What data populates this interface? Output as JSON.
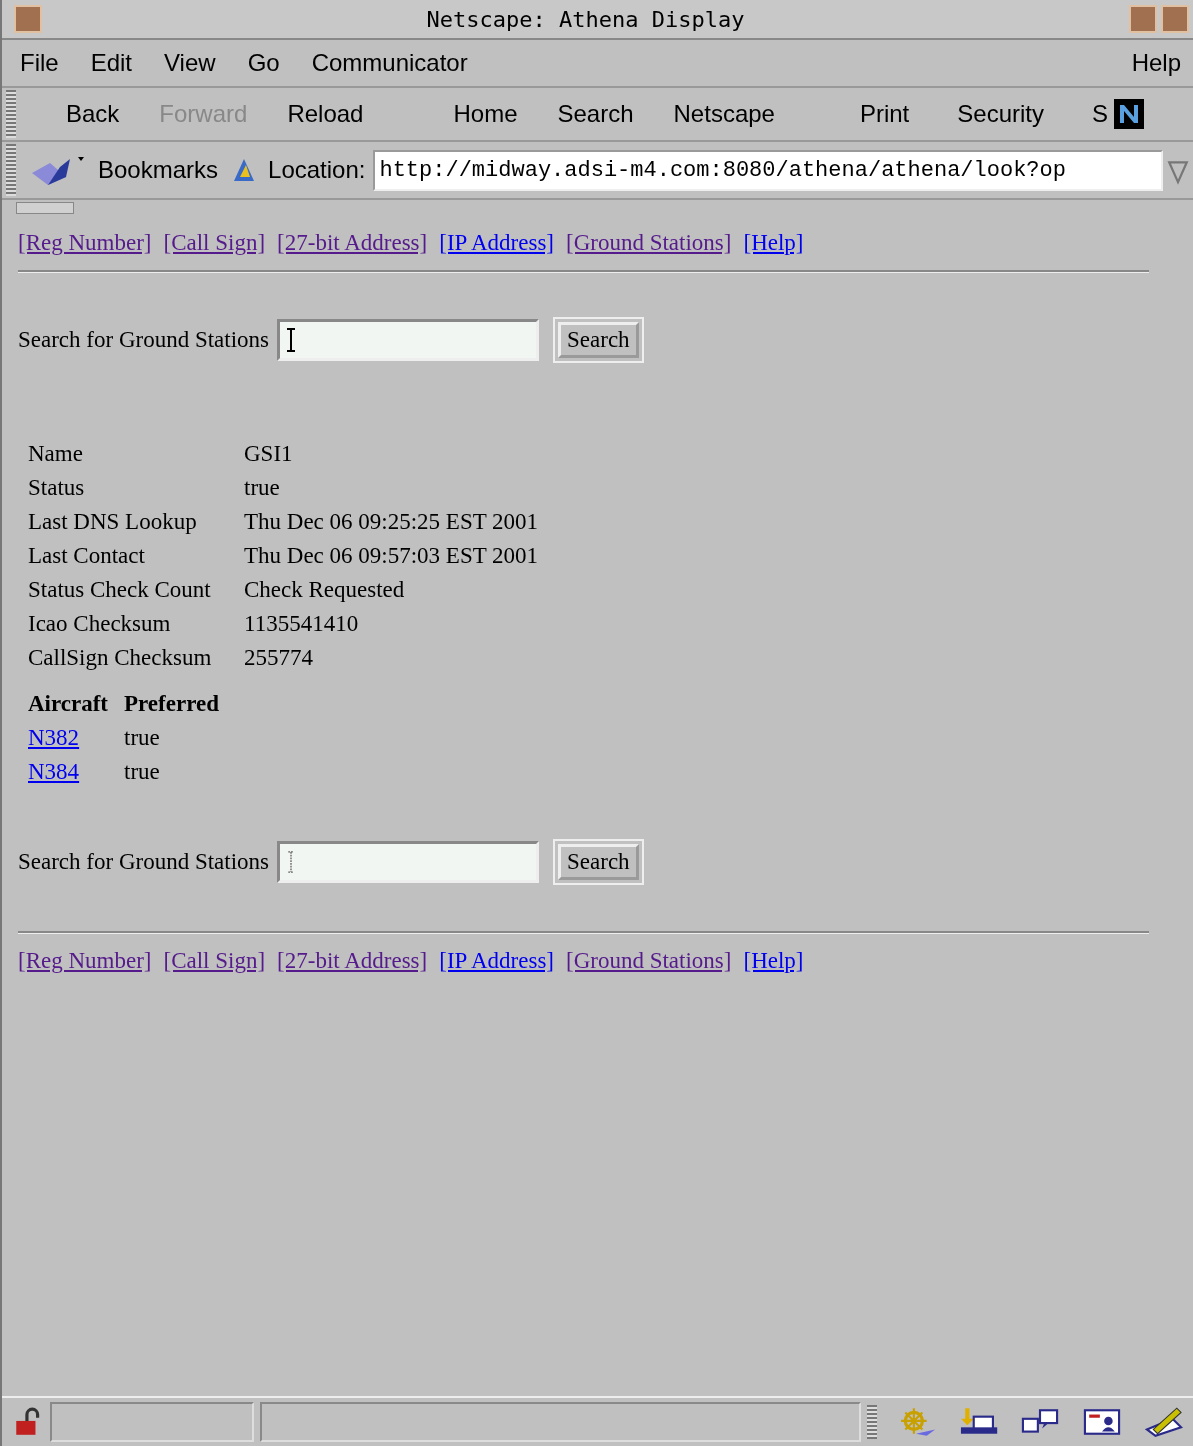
{
  "window": {
    "title": "Netscape: Athena Display"
  },
  "menu": [
    "File",
    "Edit",
    "View",
    "Go",
    "Communicator"
  ],
  "menu_help": "Help",
  "toolbar": [
    {
      "label": "Back",
      "disabled": false
    },
    {
      "label": "Forward",
      "disabled": true
    },
    {
      "label": "Reload",
      "disabled": false
    },
    {
      "label": "Home",
      "disabled": false
    },
    {
      "label": "Search",
      "disabled": false
    },
    {
      "label": "Netscape",
      "disabled": false
    },
    {
      "label": "Print",
      "disabled": false
    },
    {
      "label": "Security",
      "disabled": false
    },
    {
      "label": "S",
      "disabled": false
    }
  ],
  "location_bar": {
    "bookmarks": "Bookmarks",
    "label": "Location:",
    "url": "http://midway.adsi-m4.com:8080/athena/athena/look?op"
  },
  "nav_links_top": [
    {
      "text": "[Reg Number]",
      "visited": true
    },
    {
      "text": "[Call Sign]",
      "visited": true
    },
    {
      "text": "[27-bit Address]",
      "visited": true
    },
    {
      "text": "[IP Address]",
      "visited": false
    },
    {
      "text": "[Ground Stations]",
      "visited": true
    },
    {
      "text": "[Help]",
      "visited": false
    }
  ],
  "search_top": {
    "label": "Search for Ground Stations",
    "button": "Search"
  },
  "details": [
    {
      "label": "Name",
      "value": "GSI1"
    },
    {
      "label": "Status",
      "value": "true"
    },
    {
      "label": "Last DNS Lookup",
      "value": "Thu Dec 06 09:25:25 EST 2001"
    },
    {
      "label": "Last Contact",
      "value": "Thu Dec 06 09:57:03 EST 2001"
    },
    {
      "label": "Status Check Count",
      "value": "Check Requested"
    },
    {
      "label": "Icao Checksum",
      "value": "1135541410"
    },
    {
      "label": "CallSign Checksum",
      "value": "255774"
    }
  ],
  "aircraft_table": {
    "columns": [
      "Aircraft",
      "Preferred"
    ],
    "rows": [
      {
        "aircraft": "N382",
        "preferred": "true"
      },
      {
        "aircraft": "N384",
        "preferred": "true"
      }
    ]
  },
  "search_bottom": {
    "label": "Search for Ground Stations",
    "button": "Search"
  },
  "nav_links_bottom": [
    {
      "text": "[Reg Number]",
      "visited": true
    },
    {
      "text": "[Call Sign]",
      "visited": true
    },
    {
      "text": "[27-bit Address]",
      "visited": true
    },
    {
      "text": "[IP Address]",
      "visited": false
    },
    {
      "text": "[Ground Stations]",
      "visited": true
    },
    {
      "text": "[Help]",
      "visited": false
    }
  ]
}
